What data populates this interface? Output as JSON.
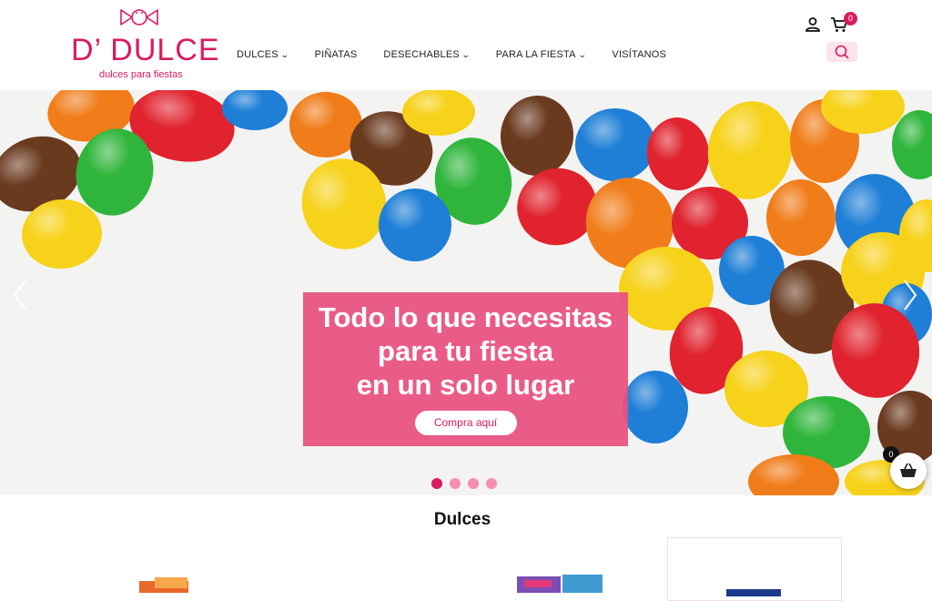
{
  "header": {
    "logo": {
      "title": "D’ DULCE",
      "tagline": "dulces para fiestas"
    },
    "nav": [
      {
        "label": "DULCES",
        "has_dropdown": true
      },
      {
        "label": "PIÑATAS",
        "has_dropdown": false
      },
      {
        "label": "DESECHABLES",
        "has_dropdown": true
      },
      {
        "label": "PARA LA FIESTA",
        "has_dropdown": true
      },
      {
        "label": "VISÍTANOS",
        "has_dropdown": false
      }
    ],
    "cart_count": "0",
    "icons": [
      "user-icon",
      "cart-icon",
      "search-icon"
    ]
  },
  "hero": {
    "lines": [
      "Todo lo que necesitas",
      "para tu fiesta",
      "en un solo lugar"
    ],
    "cta": "Compra aquí",
    "slides": 4,
    "active_slide": 1
  },
  "floating_basket": {
    "count": "0"
  },
  "section": {
    "title": "Dulces"
  },
  "colors": {
    "brand": "#d81b60",
    "promo_bg": "#e85080",
    "dot_inactive": "#f48fb1"
  }
}
